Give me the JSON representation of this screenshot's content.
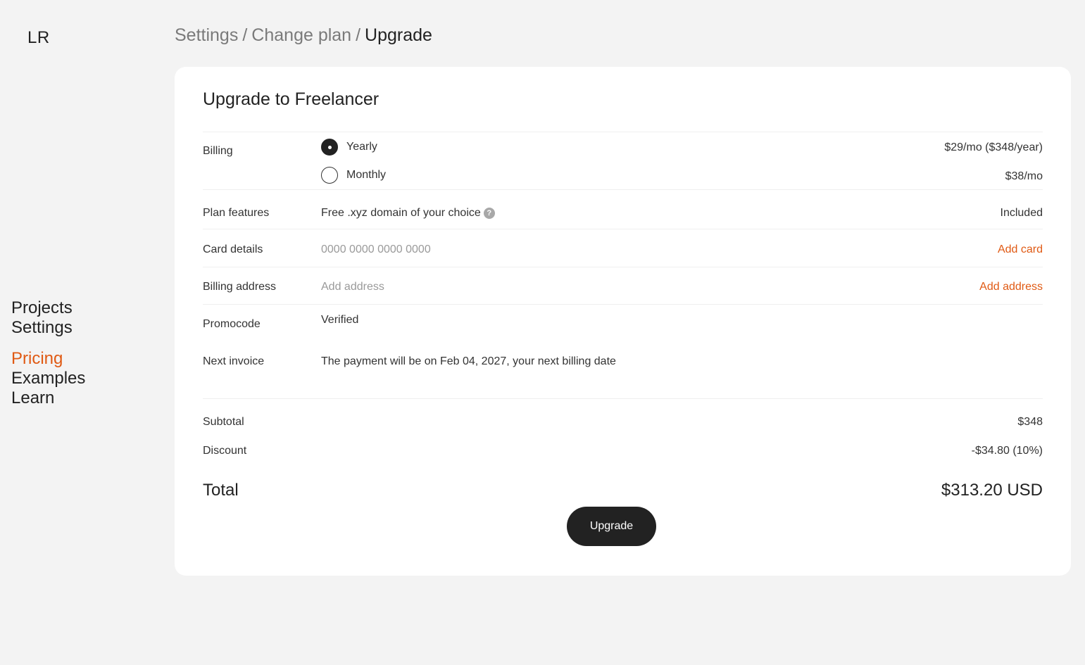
{
  "logo": "LR",
  "nav": {
    "items": [
      {
        "label": "Projects"
      },
      {
        "label": "Settings"
      },
      {
        "label": "Pricing"
      },
      {
        "label": "Examples"
      },
      {
        "label": "Learn"
      }
    ]
  },
  "breadcrumb": {
    "items": [
      "Settings",
      "Change plan",
      "Upgrade"
    ],
    "separator": "/"
  },
  "card": {
    "title": "Upgrade to Freelancer",
    "billing": {
      "label": "Billing",
      "options": [
        {
          "label": "Yearly",
          "price": "$29/mo ($348/year)",
          "selected": true
        },
        {
          "label": "Monthly",
          "price": "$38/mo",
          "selected": false
        }
      ]
    },
    "plan_features": {
      "label": "Plan features",
      "value": "Free .xyz domain of your choice",
      "help_icon": "?",
      "status": "Included"
    },
    "card_details": {
      "label": "Card details",
      "placeholder": "0000 0000 0000 0000",
      "action": "Add card"
    },
    "billing_address": {
      "label": "Billing address",
      "placeholder": "Add address",
      "action": "Add address"
    },
    "promocode": {
      "label": "Promocode",
      "value": "Verified"
    },
    "next_invoice": {
      "label": "Next invoice",
      "value": "The payment will be on Feb 04, 2027, your next billing date"
    },
    "summary": {
      "subtotal_label": "Subtotal",
      "subtotal_value": "$348",
      "discount_label": "Discount",
      "discount_value": "-$34.80 (10%)",
      "total_label": "Total",
      "total_value": "$313.20 USD"
    },
    "upgrade_button": "Upgrade"
  },
  "colors": {
    "accent": "#e05a14",
    "background": "#f3f3f3",
    "card": "#ffffff",
    "button": "#222222"
  }
}
